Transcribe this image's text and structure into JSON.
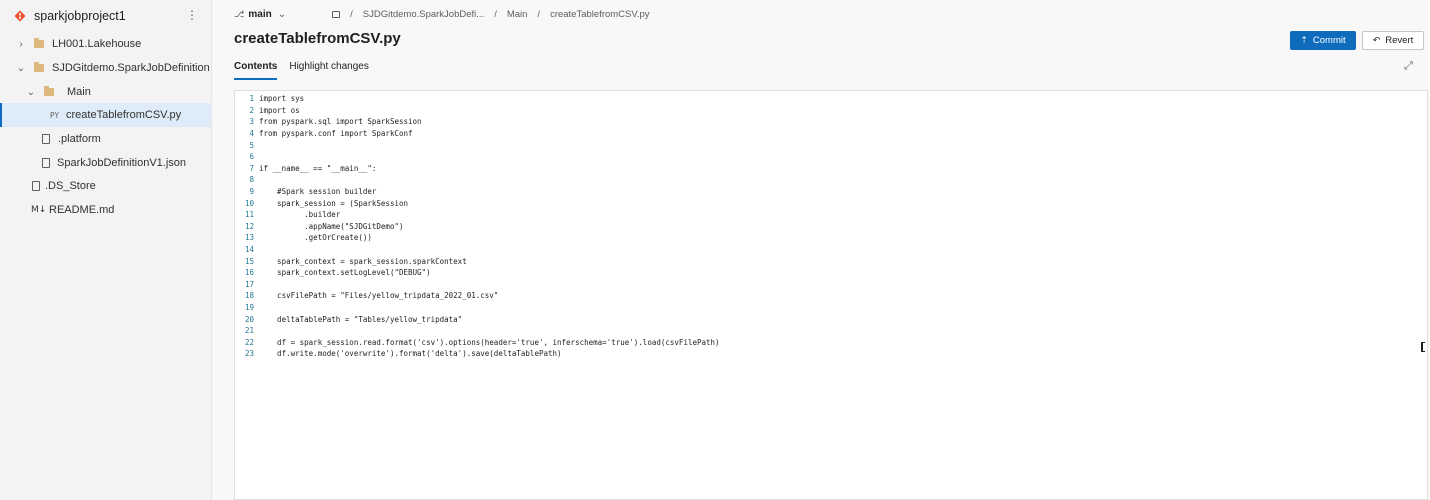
{
  "repo": {
    "name": "sparkjobproject1",
    "more": "⋮"
  },
  "tree": {
    "items": [
      {
        "label": "LH001.Lakehouse",
        "chevron": "›",
        "icon": "folder-icon"
      },
      {
        "label": "SJDGitdemo.SparkJobDefinition",
        "chevron": "⌄",
        "icon": "folder-icon"
      },
      {
        "label": "Main",
        "chevron": "⌄",
        "icon": "folder-icon"
      },
      {
        "label": "createTablefromCSV.py",
        "icon": "python-file-icon",
        "icon_text": "PY",
        "selected": true
      },
      {
        "label": ".platform",
        "icon": "file-icon"
      },
      {
        "label": "SparkJobDefinitionV1.json",
        "icon": "file-icon"
      },
      {
        "label": ".DS_Store",
        "icon": "file-icon"
      },
      {
        "label": "README.md",
        "icon": "markdown-icon",
        "icon_text": "M↓"
      }
    ]
  },
  "branch": {
    "icon": "⎇",
    "name": "main",
    "chevron": "⌄"
  },
  "breadcrumb": {
    "items": [
      "SJDGitdemo.SparkJobDefi...",
      "Main",
      "createTablefromCSV.py"
    ],
    "separator": "/"
  },
  "page_title": "createTablefromCSV.py",
  "buttons": {
    "commit": "Commit",
    "revert": "Revert",
    "commit_icon": "⇡",
    "revert_icon": "↶"
  },
  "tabs": [
    {
      "label": "Contents",
      "active": true
    },
    {
      "label": "Highlight changes",
      "active": false
    }
  ],
  "expand_icon": "⤢",
  "code": {
    "lines": [
      "import sys",
      "import os",
      "from pyspark.sql import SparkSession",
      "from pyspark.conf import SparkConf",
      "",
      "",
      "if __name__ == \"__main__\":",
      "",
      "    #Spark session builder",
      "    spark_session = (SparkSession",
      "          .builder",
      "          .appName(\"SJDGitDemo\")",
      "          .getOrCreate())",
      "",
      "    spark_context = spark_session.sparkContext",
      "    spark_context.setLogLevel(\"DEBUG\")",
      "",
      "    csvFilePath = \"Files/yellow_tripdata_2022_01.csv\"",
      "",
      "    deltaTablePath = \"Tables/yellow_tripdata\"",
      "",
      "    df = spark_session.read.format('csv').options(header='true', inferschema='true').load(csvFilePath)",
      "    df.write.mode('overwrite').format('delta').save(deltaTablePath)"
    ]
  },
  "colors": {
    "accent": "#0f6cbd",
    "selected_bg": "#deecf9",
    "folder": "#dcb67a",
    "repo_icon": "#e8512d"
  }
}
